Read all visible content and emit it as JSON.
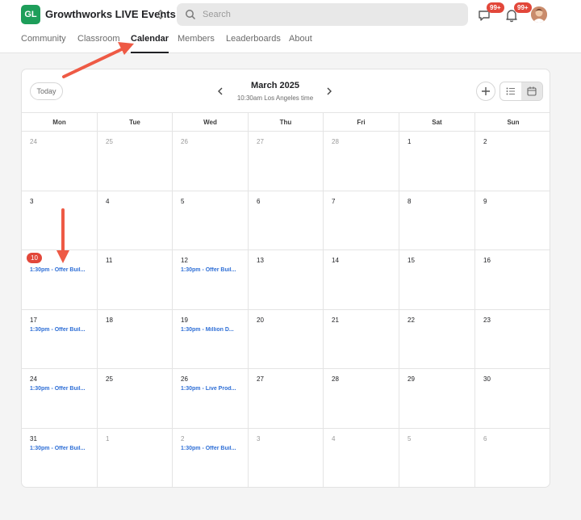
{
  "header": {
    "logo_text": "GL",
    "group_name": "Growthworks LIVE Events",
    "search_placeholder": "Search",
    "chat_badge": "99+",
    "notification_badge": "99+"
  },
  "tabs": [
    {
      "label": "Community",
      "active": false
    },
    {
      "label": "Classroom",
      "active": false
    },
    {
      "label": "Calendar",
      "active": true
    },
    {
      "label": "Members",
      "active": false
    },
    {
      "label": "Leaderboards",
      "active": false
    },
    {
      "label": "About",
      "active": false
    }
  ],
  "calendar": {
    "today_label": "Today",
    "month_title": "March 2025",
    "timezone_line": "10:30am Los Angeles time",
    "weekdays": [
      "Mon",
      "Tue",
      "Wed",
      "Thu",
      "Fri",
      "Sat",
      "Sun"
    ],
    "days": [
      {
        "num": "24",
        "muted": true
      },
      {
        "num": "25",
        "muted": true
      },
      {
        "num": "26",
        "muted": true
      },
      {
        "num": "27",
        "muted": true
      },
      {
        "num": "28",
        "muted": true
      },
      {
        "num": "1"
      },
      {
        "num": "2"
      },
      {
        "num": "3"
      },
      {
        "num": "4"
      },
      {
        "num": "5"
      },
      {
        "num": "6"
      },
      {
        "num": "7"
      },
      {
        "num": "8"
      },
      {
        "num": "9"
      },
      {
        "num": "10",
        "today": true,
        "event": "1:30pm - Offer Buil..."
      },
      {
        "num": "11"
      },
      {
        "num": "12",
        "event": "1:30pm - Offer Buil..."
      },
      {
        "num": "13"
      },
      {
        "num": "14"
      },
      {
        "num": "15"
      },
      {
        "num": "16"
      },
      {
        "num": "17",
        "event": "1:30pm - Offer Buil..."
      },
      {
        "num": "18"
      },
      {
        "num": "19",
        "event": "1:30pm - Million D..."
      },
      {
        "num": "20"
      },
      {
        "num": "21"
      },
      {
        "num": "22"
      },
      {
        "num": "23"
      },
      {
        "num": "24",
        "event": "1:30pm - Offer Buil..."
      },
      {
        "num": "25"
      },
      {
        "num": "26",
        "event": "1:30pm - Live Prod..."
      },
      {
        "num": "27"
      },
      {
        "num": "28"
      },
      {
        "num": "29"
      },
      {
        "num": "30"
      },
      {
        "num": "31",
        "event": "1:30pm - Offer Buil..."
      },
      {
        "num": "1",
        "muted": true
      },
      {
        "num": "2",
        "muted": true,
        "event": "1:30pm - Offer Buil..."
      },
      {
        "num": "3",
        "muted": true
      },
      {
        "num": "4",
        "muted": true
      },
      {
        "num": "5",
        "muted": true
      },
      {
        "num": "6",
        "muted": true
      }
    ]
  },
  "colors": {
    "brand_green": "#1e9e5a",
    "badge_red": "#e2473a",
    "event_blue": "#2f6fd6",
    "annotation_arrow": "#ee5a45"
  }
}
